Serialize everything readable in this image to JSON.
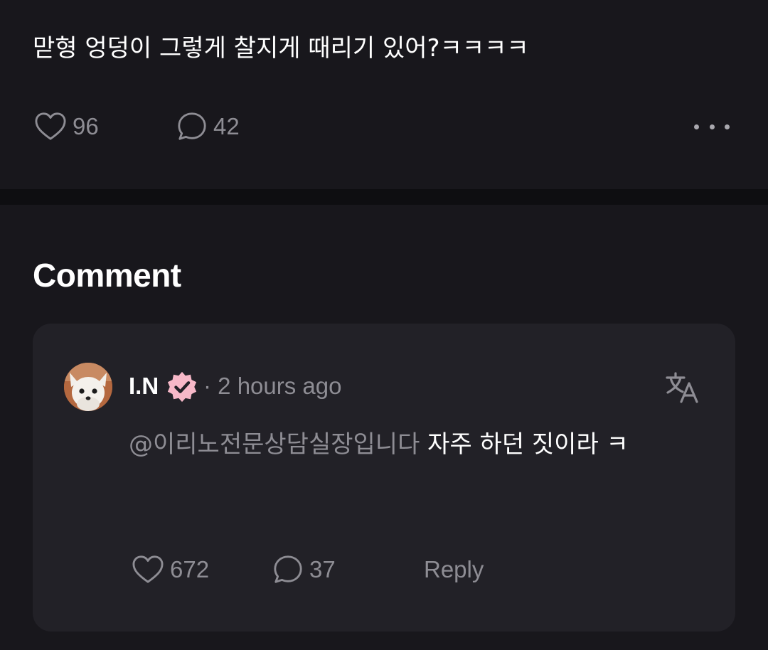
{
  "post": {
    "text": "맏형 엉덩이 그렇게 찰지게 때리기 있어?ㅋㅋㅋㅋ",
    "like_count": "96",
    "comment_count": "42"
  },
  "comments_section": {
    "title": "Comment"
  },
  "comment": {
    "username": "I.N",
    "separator": "·",
    "time_ago": "2 hours ago",
    "mention": "@이리노전문상담실장입니다",
    "text": " 자주 하던 짓이라 ㅋ",
    "like_count": "672",
    "reply_count": "37",
    "reply_label": "Reply"
  },
  "colors": {
    "background": "#18171c",
    "card": "#222127",
    "muted_text": "#8e8d94",
    "badge_pink": "#f7b8c8"
  },
  "icons": {
    "like": "heart-icon",
    "comment": "speech-bubble-icon",
    "more": "more-dots-icon",
    "verified": "verified-badge-icon",
    "translate": "translate-icon"
  }
}
